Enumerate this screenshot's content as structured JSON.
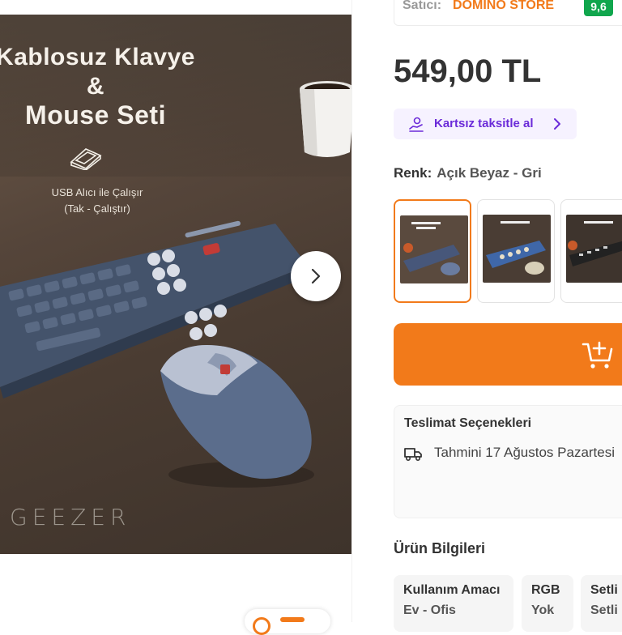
{
  "hero": {
    "line1": "Kablosuz Klavye",
    "line2": "&",
    "line3": "Mouse Seti",
    "usb_line1": "USB Alıcı ile Çalışır",
    "usb_line2": "(Tak - Çalıştır)",
    "brand": "GEEZER"
  },
  "seller": {
    "label": "Satıcı:",
    "name": "DOMINO STORE",
    "score": "9,6"
  },
  "price": "549,00 TL",
  "installment": {
    "label": "Kartsız taksitle al"
  },
  "color": {
    "label": "Renk:",
    "value": "Açık Beyaz - Gri"
  },
  "variants": [
    {
      "name": "Açık Beyaz - Gri",
      "selected": true
    },
    {
      "name": "Mavi - Krem",
      "selected": false
    },
    {
      "name": "Siyah - Gri",
      "selected": false
    }
  ],
  "delivery": {
    "title": "Teslimat Seçenekleri",
    "estimate": "Tahmini 17 Ağustos Pazartesi"
  },
  "product_info": {
    "title": "Ürün Bilgileri",
    "attributes": [
      {
        "key": "Kullanım Amacı",
        "value": "Ev - Ofis"
      },
      {
        "key": "RGB",
        "value": "Yok"
      },
      {
        "key": "Setli Ürün",
        "value": "Setli"
      }
    ]
  },
  "colors": {
    "accent": "#f27a1a",
    "score_bg": "#10a64d",
    "installment_text": "#6b2bd9",
    "installment_bg": "#f6f2ff"
  }
}
